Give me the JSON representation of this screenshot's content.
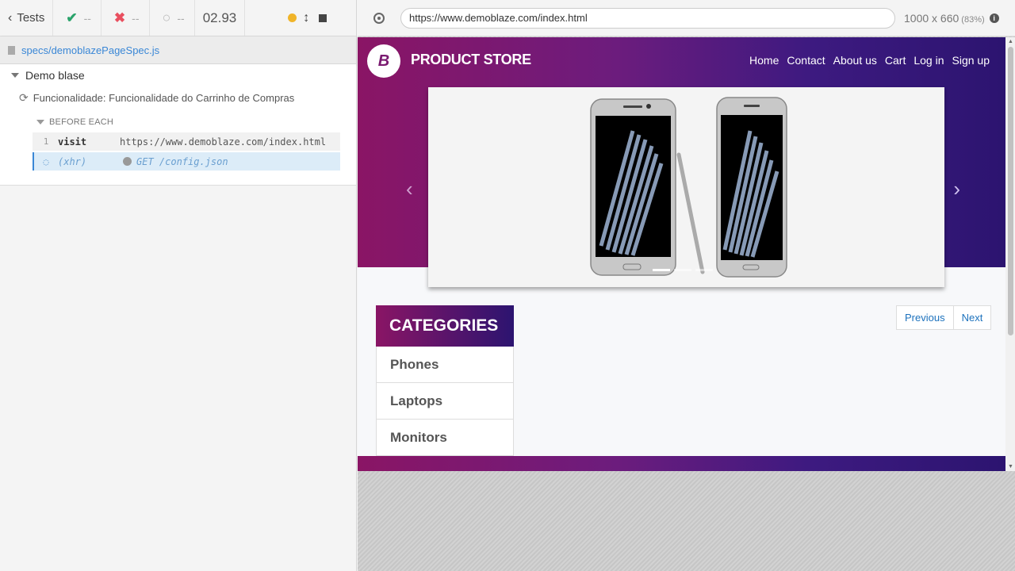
{
  "runner": {
    "tests_label": "Tests",
    "passed": "--",
    "failed": "--",
    "pending": "--",
    "duration": "02.93",
    "spec_file": "specs/demoblazePageSpec.js",
    "suite_title": "Demo blase",
    "test_title": "Funcionalidade: Funcionalidade do Carrinho de Compras",
    "hook_label": "BEFORE EACH",
    "commands": [
      {
        "num": "1",
        "name": "visit",
        "message": "https://www.demoblaze.com/index.html"
      },
      {
        "num": "",
        "name": "(xhr)",
        "message": "GET /config.json"
      }
    ]
  },
  "aut": {
    "url": "https://www.demoblaze.com/index.html",
    "viewport": "1000 x 660",
    "scale": "(83%)"
  },
  "site": {
    "brand": "PRODUCT STORE",
    "nav": [
      "Home",
      "Contact",
      "About us",
      "Cart",
      "Log in",
      "Sign up"
    ],
    "categories_title": "CATEGORIES",
    "categories": [
      "Phones",
      "Laptops",
      "Monitors"
    ],
    "pager": {
      "previous": "Previous",
      "next": "Next"
    }
  },
  "colors": {
    "brand_gradient_start": "#8a1565",
    "brand_gradient_end": "#2c1470",
    "link": "#3a87d6",
    "passed": "#2aa36b",
    "failed": "#e94f5f",
    "running": "#f0b429"
  }
}
